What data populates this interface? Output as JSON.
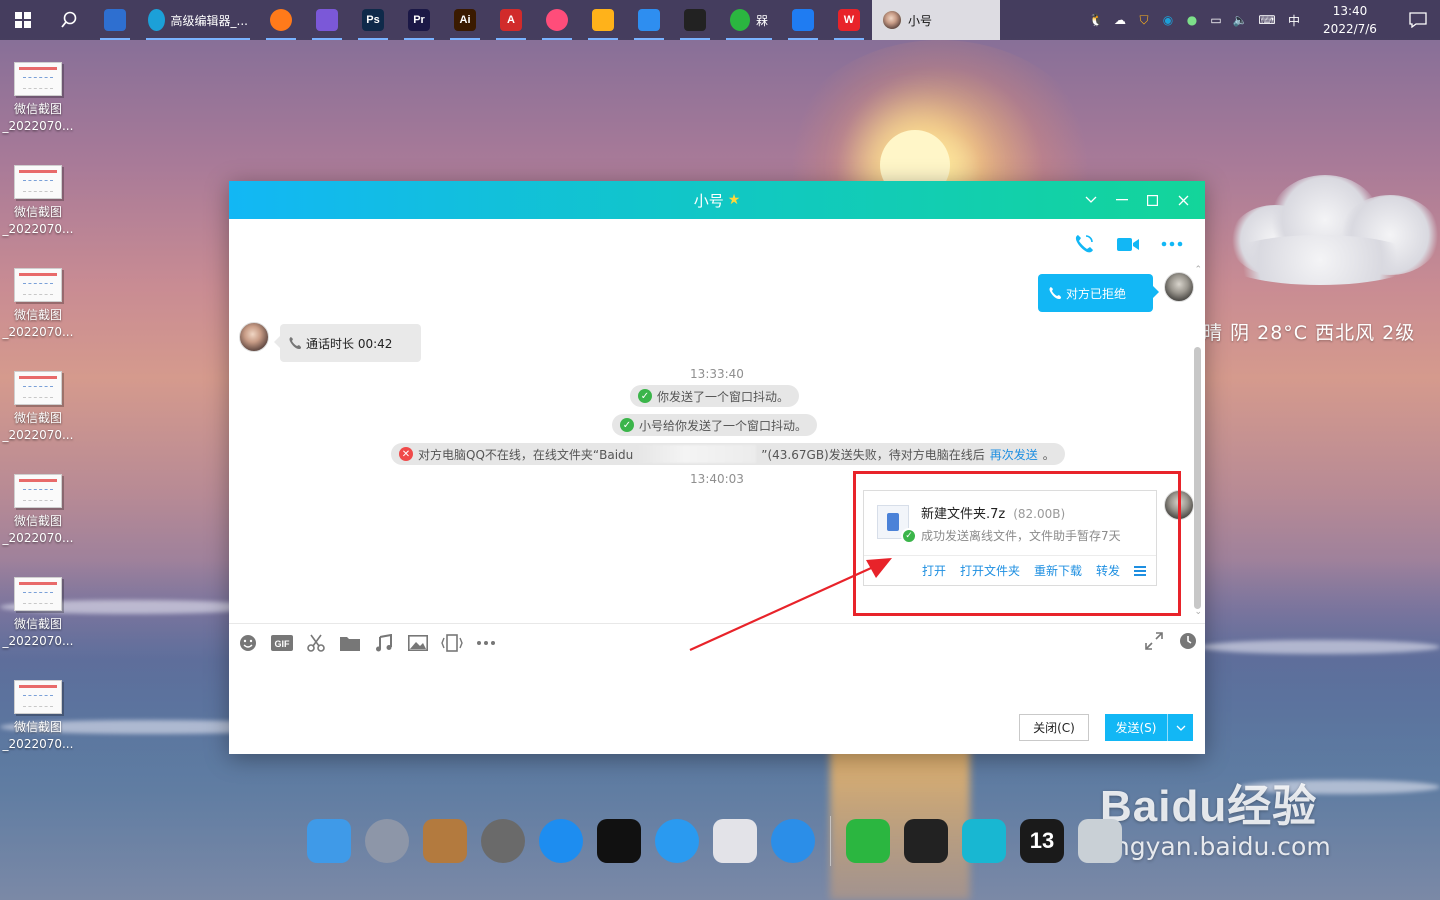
{
  "taskbar": {
    "apps": [
      {
        "id": "store",
        "icon": "store-icon",
        "color": "#2e6fd0",
        "label": ""
      },
      {
        "id": "edge-editor",
        "icon": "edge-icon",
        "color": "#1ca0d8",
        "label": "高级编辑器_..."
      },
      {
        "id": "firefox",
        "icon": "firefox-icon",
        "color": "#ff7a1a",
        "label": ""
      },
      {
        "id": "cube",
        "icon": "cube-icon",
        "color": "#7b58d8",
        "label": ""
      },
      {
        "id": "ps",
        "icon": "photoshop-icon",
        "color": "#0f2a4a",
        "label": "Ps"
      },
      {
        "id": "pr",
        "icon": "premiere-icon",
        "color": "#1b1846",
        "label": "Pr"
      },
      {
        "id": "ai",
        "icon": "illustrator-icon",
        "color": "#3a1a00",
        "label": "Ai"
      },
      {
        "id": "acrobat",
        "icon": "acrobat-icon",
        "color": "#d12b2b",
        "label": "A"
      },
      {
        "id": "meitu",
        "icon": "meitu-icon",
        "color": "#ff4d7a",
        "label": ""
      },
      {
        "id": "shield",
        "icon": "shield-icon",
        "color": "#ffb21a",
        "label": ""
      },
      {
        "id": "baidunetdisk",
        "icon": "netdisk-icon",
        "color": "#2e8ef0",
        "label": ""
      },
      {
        "id": "qq",
        "icon": "qq-icon",
        "color": "#222222",
        "label": ""
      },
      {
        "id": "wechat",
        "icon": "wechat-icon",
        "color": "#2bb640",
        "label": "槑"
      },
      {
        "id": "feishu",
        "icon": "feishu-icon",
        "color": "#1f7cf2",
        "label": ""
      },
      {
        "id": "wps",
        "icon": "wps-icon",
        "color": "#e8232a",
        "label": "W"
      }
    ],
    "active_app_label": "小号",
    "time": "13:40",
    "date": "2022/7/6",
    "ime": "中"
  },
  "desktop": {
    "icon_label_line1": "微信截图",
    "icon_label_line2": "_2022070..."
  },
  "weather": "阴  28°C  西北风  2级",
  "weather_prefix": "晴",
  "watermark": {
    "brand": "Baidu经验",
    "url": "jingyan.baidu.com"
  },
  "qq_window": {
    "title": "小号",
    "messages": {
      "me_call": "对方已拒绝",
      "peer_call": "通话时长 00:42",
      "time1": "13:33:40",
      "sys1": "你发送了一个窗口抖动。",
      "sys2": "小号给你发送了一个窗口抖动。",
      "sys3_pre": "对方电脑QQ不在线，在线文件夹“Baidu",
      "sys3_post": "”(43.67GB)发送失败，待对方电脑在线后",
      "sys3_link": "再次发送",
      "sys3_end": "。",
      "time2": "13:40:03"
    },
    "file": {
      "name": "新建文件夹.7z",
      "size": "(82.00B)",
      "status": "成功发送离线文件，文件助手暂存7天",
      "actions": [
        "打开",
        "打开文件夹",
        "重新下载",
        "转发"
      ]
    },
    "buttons": {
      "close": "关闭(C)",
      "send": "发送(S)"
    }
  },
  "dock": {
    "items": [
      {
        "icon": "finder-icon",
        "color": "#3f9ae8"
      },
      {
        "icon": "launchpad-icon",
        "color": "#8d96a8"
      },
      {
        "icon": "archive-icon",
        "color": "#b37a3e"
      },
      {
        "icon": "system-preferences-icon",
        "color": "#6a6a6a"
      },
      {
        "icon": "app-store-icon",
        "color": "#1d8df0"
      },
      {
        "icon": "slash-app-icon",
        "color": "#111111"
      },
      {
        "icon": "search-app-icon",
        "color": "#2a9af0"
      },
      {
        "icon": "more-apps-icon",
        "color": "#e3e3e8"
      },
      {
        "icon": "power-icon",
        "color": "#2b8ee8"
      },
      {
        "icon": "wechat-dock-icon",
        "color": "#2bb640"
      },
      {
        "icon": "qq-dock-icon",
        "color": "#222222"
      },
      {
        "icon": "wifi-app-icon",
        "color": "#18b7d2"
      },
      {
        "icon": "number-13-icon",
        "color": "#1a1a1a",
        "label": "13"
      },
      {
        "icon": "trash-icon",
        "color": "#c9d0d6"
      }
    ]
  }
}
